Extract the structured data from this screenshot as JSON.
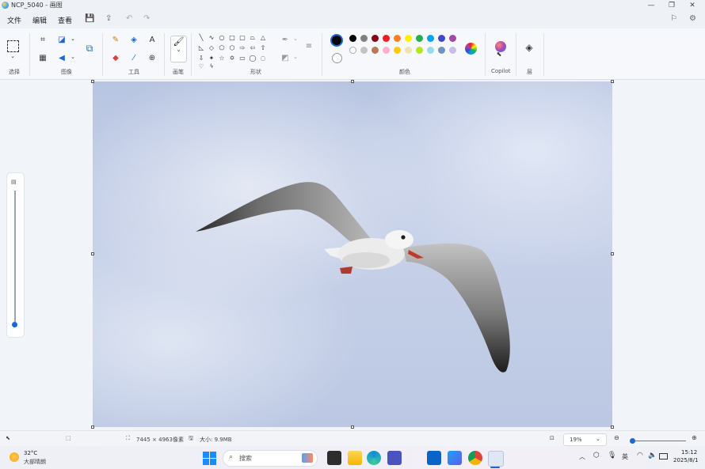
{
  "window": {
    "title": "NCP_5040 - 画图",
    "btn_min": "—",
    "btn_max": "❐",
    "btn_close": "✕"
  },
  "menu": {
    "file": "文件",
    "edit": "编辑",
    "view": "查看"
  },
  "ribbon": {
    "groups": {
      "select": "选择",
      "image": "图像",
      "tools": "工具",
      "brushes": "画笔",
      "shapes": "形状",
      "colors": "颜色",
      "copilot": "Copilot",
      "layers": "层"
    },
    "palette_row1": [
      "#000000",
      "#7f7f7f",
      "#880015",
      "#ed1c24",
      "#ff7f27",
      "#fff200",
      "#22b14c",
      "#00a2e8",
      "#3f48cc",
      "#a349a4"
    ],
    "palette_row2": [
      "#ffffff",
      "#c3c3c3",
      "#b97a57",
      "#ffaec9",
      "#ffc90e",
      "#efe4b0",
      "#b5e61d",
      "#99d9ea",
      "#7092be",
      "#c8bfe7"
    ],
    "primary_color": "#000000",
    "secondary_color": "#ffffff",
    "accent_color": "#1967d2"
  },
  "status": {
    "dimensions": "7445 × 4963像素",
    "size": "大小: 9.9MB",
    "zoom": "19%"
  },
  "taskbar": {
    "weather_temp": "32°C",
    "weather_desc": "大部晴朗",
    "search": "搜索",
    "time": "15:12",
    "date": "2025/8/1",
    "ime": "英",
    "apps": [
      "start",
      "search",
      "widgets",
      "file-explorer",
      "edge",
      "teams",
      "outlook",
      "store",
      "chrome",
      "paint"
    ]
  }
}
